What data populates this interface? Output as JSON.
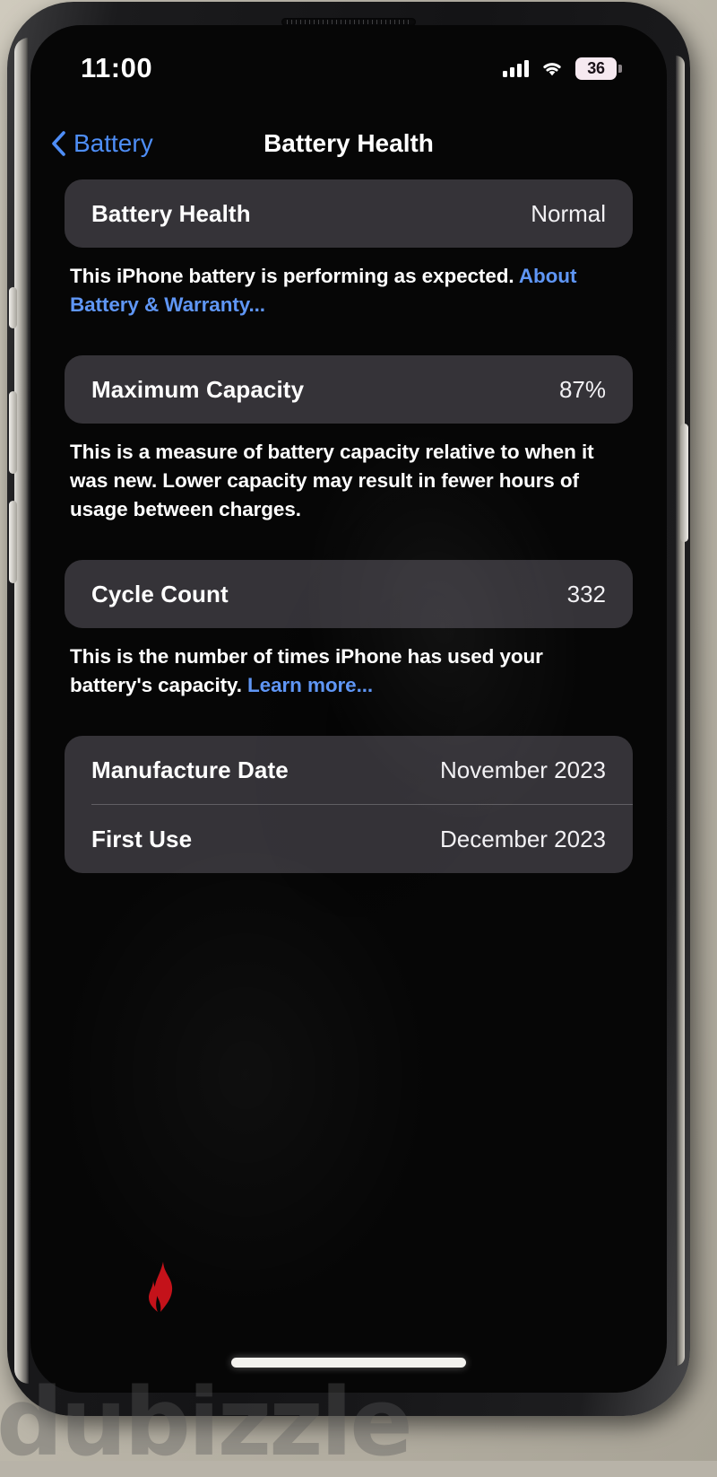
{
  "status_bar": {
    "time": "11:00",
    "cellular_icon": "cellular-bars-icon",
    "wifi_icon": "wifi-icon",
    "battery_icon": "battery-icon",
    "battery_percent": "36"
  },
  "nav": {
    "back_label": "Battery",
    "back_icon": "chevron-left-icon",
    "title": "Battery Health"
  },
  "sections": {
    "health": {
      "label": "Battery Health",
      "value": "Normal",
      "footnote_text": "This iPhone battery is performing as expected. ",
      "footnote_link": "About Battery & Warranty..."
    },
    "capacity": {
      "label": "Maximum Capacity",
      "value": "87%",
      "footnote_text": "This is a measure of battery capacity relative to when it was new. Lower capacity may result in fewer hours of usage between charges."
    },
    "cycles": {
      "label": "Cycle Count",
      "value": "332",
      "footnote_text": "This is the number of times iPhone has used your battery's capacity. ",
      "footnote_link": "Learn more..."
    },
    "dates": {
      "manufacture_label": "Manufacture Date",
      "manufacture_value": "November 2023",
      "first_use_label": "First Use",
      "first_use_value": "December 2023"
    }
  },
  "watermark": {
    "text": "dubizzle"
  },
  "colors": {
    "link_blue": "#5f96f5",
    "back_blue": "#4e8ef7",
    "card_grey": "#78727e",
    "screen_black": "#060606",
    "battery_badge": "#f6e9f0",
    "flame_red": "#c4121a"
  }
}
